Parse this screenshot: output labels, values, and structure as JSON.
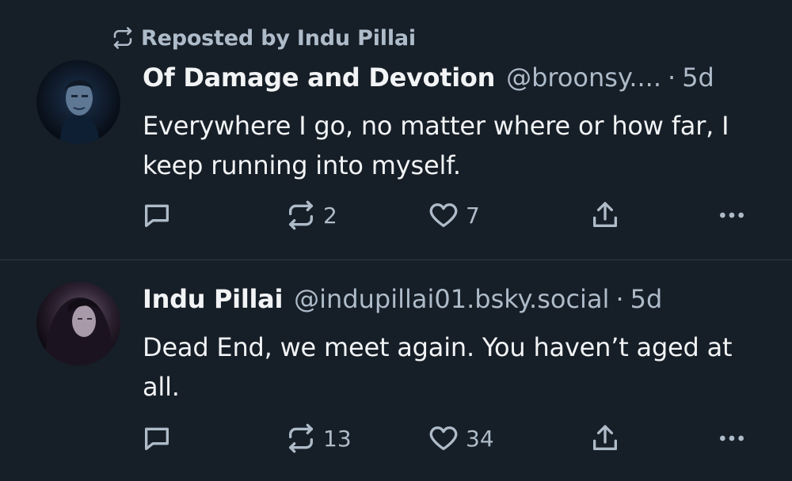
{
  "colors": {
    "background": "#161e27",
    "divider": "#2e3a48",
    "primary_text": "#f1f3f5",
    "secondary_text": "#aebbc9"
  },
  "posts": [
    {
      "repost_label": "Reposted by Indu Pillai",
      "repost_icon": "repost-icon",
      "author_name": "Of Damage and Devotion",
      "author_handle": "@broonsy....",
      "time_separator": "·",
      "time": "5d",
      "text": "Everywhere I go, no matter where or how far, I keep running into myself.",
      "reply_icon": "reply-icon",
      "repost_count": "2",
      "like_count": "7",
      "share_icon": "share-icon",
      "more_icon": "more-icon"
    },
    {
      "author_name": "Indu Pillai",
      "author_handle": "@indupillai01.bsky.social",
      "time_separator": "·",
      "time": "5d",
      "text": "Dead End, we meet again. You haven’t aged at all.",
      "reply_icon": "reply-icon",
      "repost_count": "13",
      "like_count": "34",
      "share_icon": "share-icon",
      "more_icon": "more-icon"
    }
  ]
}
